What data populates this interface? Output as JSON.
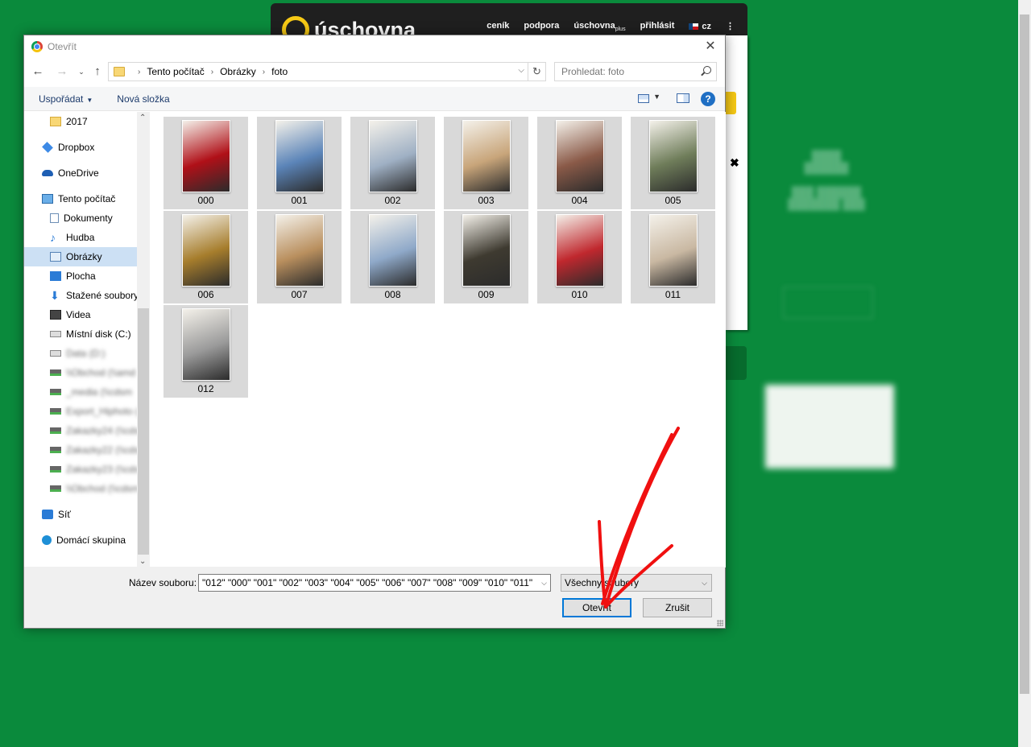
{
  "site": {
    "logo_text": "úschovna",
    "nav": [
      "ceník",
      "podpora",
      "úschovna",
      "přihlásit"
    ],
    "nav_sub": "plus",
    "lang": "cz"
  },
  "dialog": {
    "title": "Otevřít",
    "breadcrumbs": [
      "Tento počítač",
      "Obrázky",
      "foto"
    ],
    "search_placeholder": "Prohledat: foto",
    "toolbar": {
      "organize": "Uspořádat",
      "new_folder": "Nová složka"
    },
    "nav_items": [
      {
        "label": "2017",
        "icon": "folder-icon",
        "sub": true
      },
      {
        "label": "Dropbox",
        "icon": "dropbox-icon"
      },
      {
        "label": "OneDrive",
        "icon": "onedrive-icon"
      },
      {
        "label": "Tento počítač",
        "icon": "computer-icon"
      },
      {
        "label": "Dokumenty",
        "icon": "documents-icon",
        "sub": true
      },
      {
        "label": "Hudba",
        "icon": "music-icon",
        "sub": true
      },
      {
        "label": "Obrázky",
        "icon": "pictures-icon",
        "sub": true,
        "selected": true
      },
      {
        "label": "Plocha",
        "icon": "desktop-icon",
        "sub": true
      },
      {
        "label": "Stažené soubory",
        "icon": "downloads-icon",
        "sub": true
      },
      {
        "label": "Videa",
        "icon": "videos-icon",
        "sub": true
      },
      {
        "label": "Místní disk (C:)",
        "icon": "drive-icon",
        "sub": true
      },
      {
        "label": "Data (D:)",
        "icon": "drive-icon",
        "sub": true,
        "blurred": true
      },
      {
        "label": "\\\\Obchod (\\\\amd",
        "icon": "network-drive-icon",
        "sub": true,
        "blurred": true
      },
      {
        "label": "_media (\\\\cdsm",
        "icon": "network-drive-icon",
        "sub": true,
        "blurred": true
      },
      {
        "label": "Export_Hiphoto (",
        "icon": "network-drive-icon",
        "sub": true,
        "blurred": true
      },
      {
        "label": "Zakazky24 (\\\\cdsr",
        "icon": "network-drive-icon",
        "sub": true,
        "blurred": true
      },
      {
        "label": "Zakazky22 (\\\\cdsr",
        "icon": "network-drive-icon",
        "sub": true,
        "blurred": true
      },
      {
        "label": "Zakazky23 (\\\\cds",
        "icon": "network-drive-icon",
        "sub": true,
        "blurred": true
      },
      {
        "label": "\\\\Obchod (\\\\cdsm",
        "icon": "network-drive-icon",
        "sub": true,
        "blurred": true
      },
      {
        "label": "Síť",
        "icon": "network-icon"
      },
      {
        "label": "Domácí skupina",
        "icon": "homegroup-icon"
      }
    ],
    "files": [
      {
        "name": "000",
        "tone": "#b01018"
      },
      {
        "name": "001",
        "tone": "#5b84b8"
      },
      {
        "name": "002",
        "tone": "#9fb0c4"
      },
      {
        "name": "003",
        "tone": "#c8a57a"
      },
      {
        "name": "004",
        "tone": "#8a5a48"
      },
      {
        "name": "005",
        "tone": "#6f7d5a"
      },
      {
        "name": "006",
        "tone": "#a67d2c"
      },
      {
        "name": "007",
        "tone": "#b98f5e"
      },
      {
        "name": "008",
        "tone": "#8fa9c9"
      },
      {
        "name": "009",
        "tone": "#3e3a30"
      },
      {
        "name": "010",
        "tone": "#c0282e"
      },
      {
        "name": "011",
        "tone": "#c9b8a2"
      },
      {
        "name": "012",
        "tone": "#9a9a9a"
      }
    ],
    "filename_label": "Název souboru:",
    "filename_value": "\"012\" \"000\" \"001\" \"002\" \"003\" \"004\" \"005\" \"006\" \"007\" \"008\" \"009\" \"010\" \"011\"",
    "filetype": "Všechny soubory",
    "open_button": "Otevřít",
    "cancel_button": "Zrušit"
  }
}
